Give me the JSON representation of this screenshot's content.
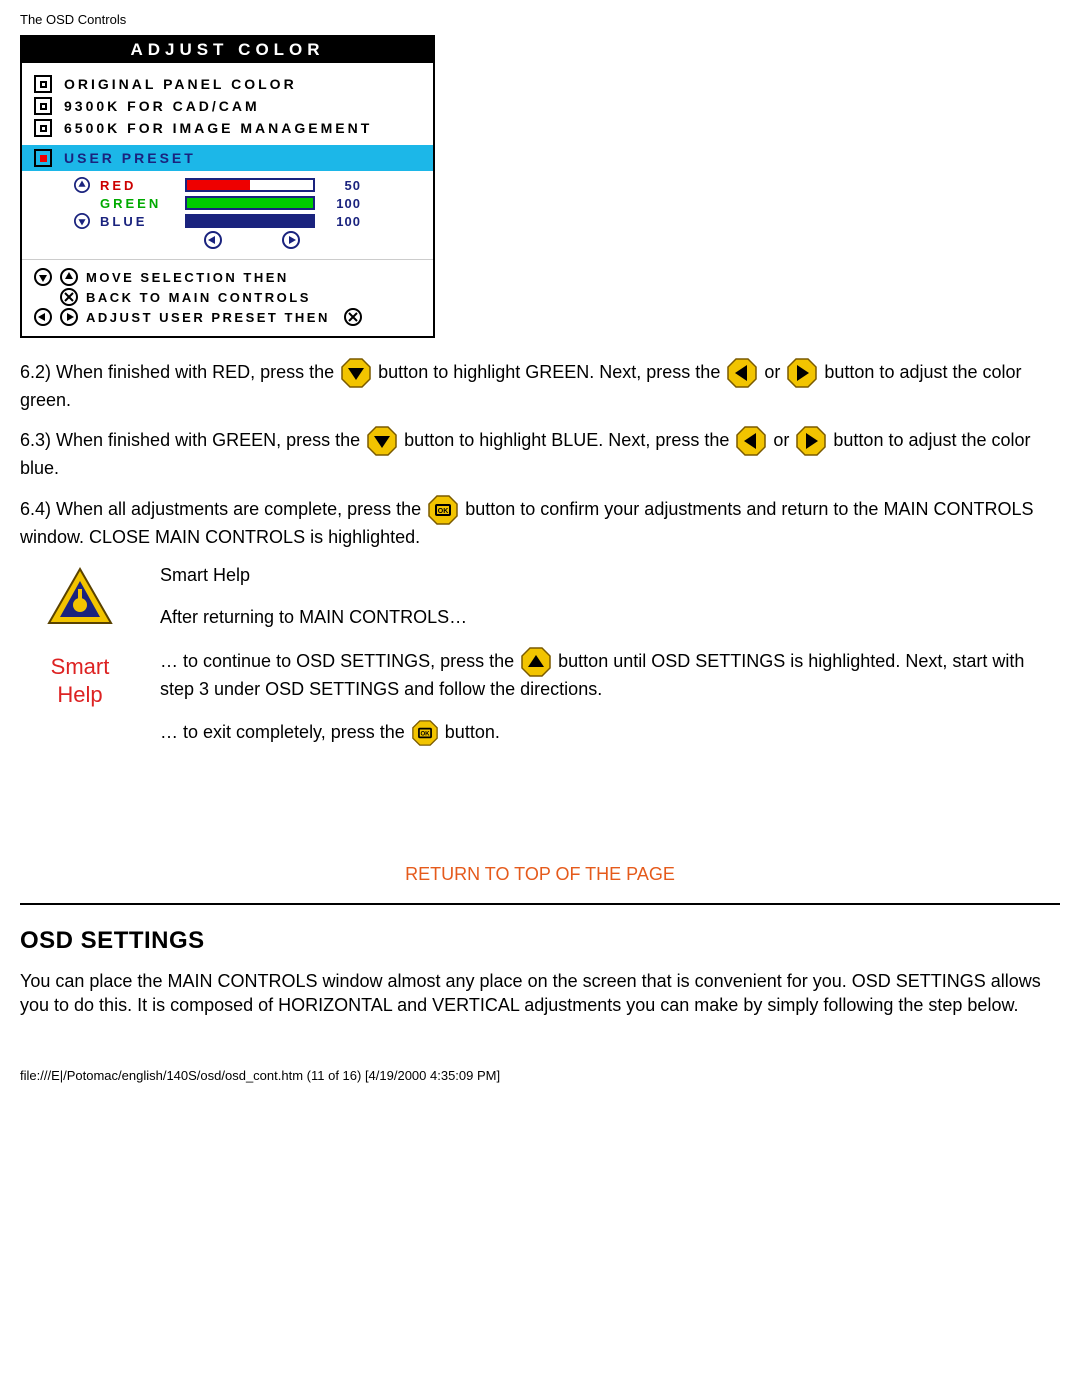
{
  "header": "The OSD Controls",
  "osd": {
    "title": "ADJUST COLOR",
    "options": [
      "ORIGINAL PANEL COLOR",
      "9300K FOR CAD/CAM",
      "6500K FOR IMAGE MANAGEMENT"
    ],
    "user_preset_label": "USER PRESET",
    "presets": {
      "red": {
        "label": "RED",
        "value": "50"
      },
      "green": {
        "label": "GREEN",
        "value": "100"
      },
      "blue": {
        "label": "BLUE",
        "value": "100"
      }
    },
    "hints": {
      "move": "MOVE SELECTION THEN",
      "back": "BACK TO MAIN CONTROLS",
      "adjust": "ADJUST USER PRESET THEN"
    }
  },
  "steps": {
    "s62a": "6.2) When finished with RED, press the ",
    "s62b": " button to highlight GREEN. Next, press the ",
    "s62c": " or ",
    "s62d": " button to adjust the color green.",
    "s63a": "6.3) When finished with GREEN, press the ",
    "s63b": " button to highlight BLUE. Next, press the ",
    "s63c": " or ",
    "s63d": " button to adjust the color blue.",
    "s64a": "6.4) When all adjustments are complete, press the ",
    "s64b": " button to confirm your adjustments and return to the MAIN CONTROLS window. CLOSE MAIN CONTROLS is highlighted."
  },
  "smarthelp": {
    "label_line1": "Smart",
    "label_line2": "Help",
    "heading": "Smart Help",
    "after": "After returning to MAIN CONTROLS…",
    "p1a": "… to continue to OSD SETTINGS, press the ",
    "p1b": " button until OSD SETTINGS is highlighted. Next, start with step 3 under OSD SETTINGS and follow the directions.",
    "p2a": "… to exit completely, press the ",
    "p2b": " button."
  },
  "return_link": "RETURN TO TOP OF THE PAGE",
  "section_title": "OSD SETTINGS",
  "section_body": "You can place the MAIN CONTROLS window almost any place on the screen that is convenient for you. OSD SETTINGS allows you to do this. It is composed of HORIZONTAL and VERTICAL adjustments you can make by simply following the step below.",
  "footer": "file:///E|/Potomac/english/140S/osd/osd_cont.htm (11 of 16) [4/19/2000 4:35:09 PM]"
}
